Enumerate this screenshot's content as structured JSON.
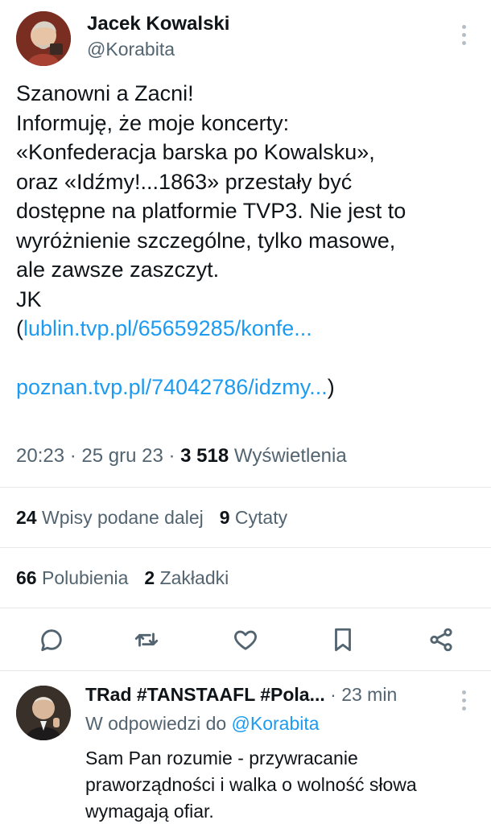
{
  "tweet": {
    "author_name": "Jacek Kowalski",
    "author_handle": "@Korabita",
    "lines": [
      "Szanowni a Zacni!",
      "Informuję, że moje koncerty:",
      "«Konfederacja barska po Kowalsku»,",
      "oraz «Idźmy!...1863» przestały być",
      "dostępne na platformie TVP3. Nie jest to",
      "wyróżnienie szczególne, tylko masowe,",
      "ale zawsze zaszczyt.",
      "JK"
    ],
    "link1_prefix": "(",
    "link1": "lublin.tvp.pl/65659285/konfe...",
    "link2": "poznan.tvp.pl/74042786/idzmy...",
    "link2_suffix": ")",
    "time": "20:23",
    "sep": " · ",
    "date": "25 gru 23",
    "views_count": "3 518",
    "views_label": "Wyświetlenia"
  },
  "stats": {
    "retweets_count": "24",
    "retweets_label": "Wpisy podane dalej",
    "quotes_count": "9",
    "quotes_label": "Cytaty",
    "likes_count": "66",
    "likes_label": "Polubienia",
    "bookmarks_count": "2",
    "bookmarks_label": "Zakładki"
  },
  "actions": {
    "icons": [
      "reply-icon",
      "retweet-icon",
      "like-icon",
      "bookmark-icon",
      "share-icon"
    ]
  },
  "reply": {
    "name": "TRad #TANSTAAFL #Pola...",
    "time": "· 23 min",
    "reply_to_label": "W odpowiedzi do",
    "reply_to_handle": "@Korabita",
    "lines": [
      "Sam Pan rozumie - przywracanie",
      "praworządności i walka o wolność słowa",
      "wymagają ofiar."
    ]
  },
  "colors": {
    "link": "#1d9bf0",
    "secondary_text": "#536471",
    "primary_text": "#0f1419",
    "divider": "#e6e9eb"
  }
}
